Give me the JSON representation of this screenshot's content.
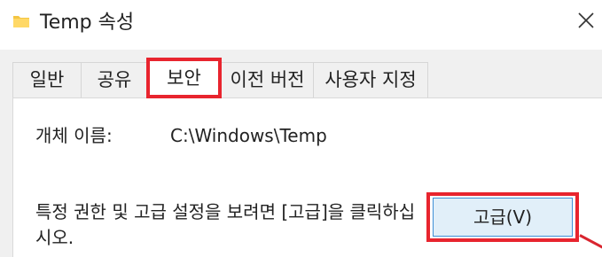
{
  "window": {
    "title": "Temp 속성",
    "icon": "folder-icon",
    "close_icon": "close-icon"
  },
  "tabs": [
    {
      "label": "일반",
      "active": false
    },
    {
      "label": "공유",
      "active": false
    },
    {
      "label": "보안",
      "active": true
    },
    {
      "label": "이전 버전",
      "active": false
    },
    {
      "label": "사용자 지정",
      "active": false
    }
  ],
  "security": {
    "object_name_label": "개체 이름:",
    "object_name_value": "C:\\Windows\\Temp",
    "advanced_description": "특정 권한 및 고급 설정을 보려면 [고급]을 클릭하십시오.",
    "advanced_button_label": "고급(V)"
  },
  "colors": {
    "highlight": "#e8242e",
    "button_bg": "#e1eff9",
    "button_border": "#3f8fd6",
    "folder": "#f4c542"
  }
}
